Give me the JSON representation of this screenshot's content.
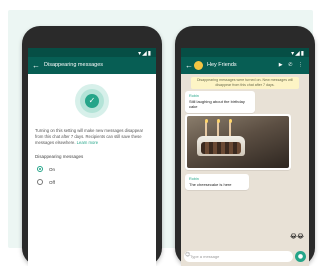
{
  "left_phone": {
    "status_icons": "▾◢▮",
    "appbar": {
      "back_icon": "←",
      "title": "Disappearing messages"
    },
    "timer_icon": "✓",
    "description": "Turning on this setting will make new messages disappear from this chat after 7 days. Recipients can still save these messages elsewhere.",
    "learn_more": "Learn more",
    "section_label": "Disappearing messages",
    "options": [
      {
        "label": "On",
        "selected": true
      },
      {
        "label": "Off",
        "selected": false
      }
    ]
  },
  "right_phone": {
    "status_icons": "▾◢▮",
    "appbar": {
      "back_icon": "←",
      "title": "Hey Friends",
      "action_icons": "▶ ✆ ⋮"
    },
    "system_notice": "Disappearing messages were turned on. New messages will disappear from this chat after 7 days.",
    "messages": [
      {
        "sender": "Robin",
        "text": "Still laughing about the birthday cake"
      },
      {
        "sender": "Robin",
        "text": "The cheesecake is here"
      }
    ],
    "emoji_reaction": "😂😂",
    "composer_placeholder": "Type a message",
    "composer_emoji_icon": "☺",
    "mic_icon": "●"
  },
  "colors": {
    "whatsapp_green": "#075e54",
    "accent": "#25a589",
    "chat_background": "#e8e1d6"
  }
}
